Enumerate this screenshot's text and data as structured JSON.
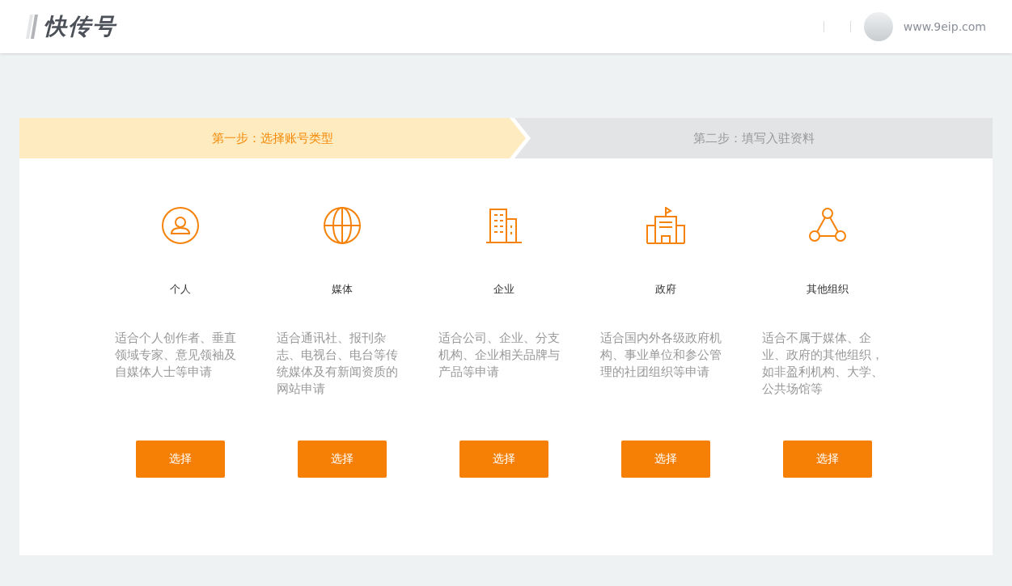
{
  "header": {
    "logo": "快传号",
    "user": {
      "name": "www.9eip.com"
    }
  },
  "steps": [
    {
      "label": "第一步：选择账号类型",
      "selected": true
    },
    {
      "label": "第二步：填写入驻资料",
      "selected": false
    }
  ],
  "account_types": [
    {
      "kind": "person",
      "title": "个人",
      "description": "适合个人创作者、垂直领域专家、意见领袖及自媒体人士等申请",
      "button": "选择"
    },
    {
      "kind": "globe",
      "title": "媒体",
      "description": "适合通讯社、报刊杂志、电视台、电台等传统媒体及有新闻资质的网站申请",
      "button": "选择"
    },
    {
      "kind": "building",
      "title": "企业",
      "description": "适合公司、企业、分支机构、企业相关品牌与产品等申请",
      "button": "选择"
    },
    {
      "kind": "government",
      "title": "政府",
      "description": "适合国内外各级政府机构、事业单位和参公管理的社团组织等申请",
      "button": "选择"
    },
    {
      "kind": "network",
      "title": "其他组织",
      "description": "适合不属于媒体、企业、政府的其他组织，如非盈利机构、大学、公共场馆等",
      "button": "选择"
    }
  ]
}
